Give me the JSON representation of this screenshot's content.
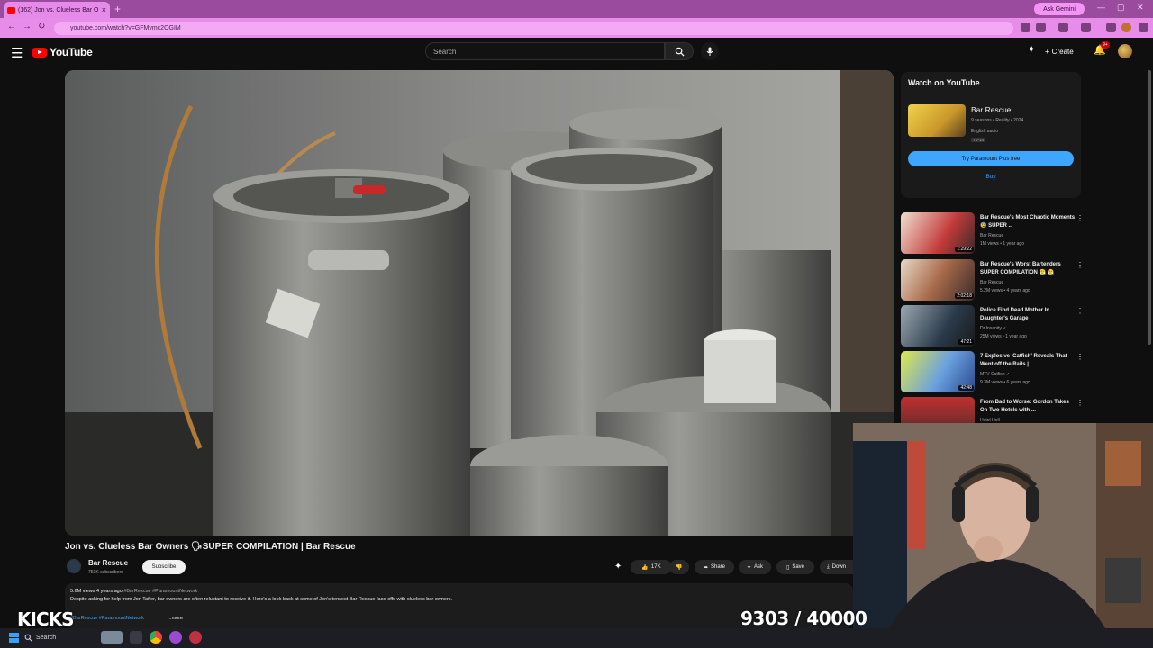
{
  "browser": {
    "tab_title": "(162) Jon vs. Clueless Bar O",
    "new_tab_label": "+",
    "gemini_label": "Ask Gemini",
    "url": "youtube.com/watch?v=GFMvmc2OGIM",
    "window_controls": [
      "—",
      "▢",
      "✕"
    ]
  },
  "header": {
    "logo_text": "YouTube",
    "search_placeholder": "Search",
    "create_label": "Create",
    "notif_count": "9+"
  },
  "video": {
    "title": "Jon vs. Clueless Bar Owners 🗣SUPER COMPILATION | Bar Rescue",
    "channel_name": "Bar Rescue",
    "channel_subs": "753K subscribers",
    "subscribe_label": "Subscribe",
    "like_count": "17K",
    "share_label": "Share",
    "ask_label": "Ask",
    "save_label": "Save",
    "download_label": "Down"
  },
  "description": {
    "views_date": "5.6M views  4 years ago",
    "hashtags": "#BarRescue #ParamountNetwork",
    "text": "Despite asking for help from Jon Taffer, bar owners are often reluctant to receive it. Here's a look back at some of Jon's tensest Bar Rescue face-offs with clueless bar owners.",
    "tags_line2": "#BarRescue #ParamountNetwork",
    "more_label": "...more"
  },
  "watch_on_youtube": {
    "heading": "Watch on YouTube",
    "show_name": "Bar Rescue",
    "show_info": "9 seasons • Reality • 2024",
    "audio": "English audio",
    "rating": "TV-14",
    "try_label": "Try Paramount Plus free",
    "buy_label": "Buy"
  },
  "recommendations": [
    {
      "title": "Bar Rescue's Most Chaotic Moments 😨 SUPER ...",
      "channel": "Bar Rescue",
      "meta": "1M views • 1 year ago",
      "duration": "1:29:22"
    },
    {
      "title": "Bar Rescue's Worst Bartenders SUPER COMPILATION 😤 😤",
      "channel": "Bar Rescue",
      "meta": "5.2M views • 4 years ago",
      "duration": "2:02:18"
    },
    {
      "title": "Police Find Dead Mother In Daughter's Garage",
      "channel": "Dr Insanity ✓",
      "meta": "25M views • 1 year ago",
      "duration": "47:21"
    },
    {
      "title": "7 Explosive 'Catfish' Reveals That Went off the Rails | ...",
      "channel": "MTV Catfish ✓",
      "meta": "9.3M views • 6 years ago",
      "duration": "42:48"
    },
    {
      "title": "From Bad to Worse: Gordon Takes On Two Hotels with ...",
      "channel": "Hotel Hell",
      "meta": "",
      "duration": ""
    }
  ],
  "overlay": {
    "kicks": "KICKS",
    "counter": "9303 / 40000"
  },
  "taskbar": {
    "search_label": "Search"
  }
}
